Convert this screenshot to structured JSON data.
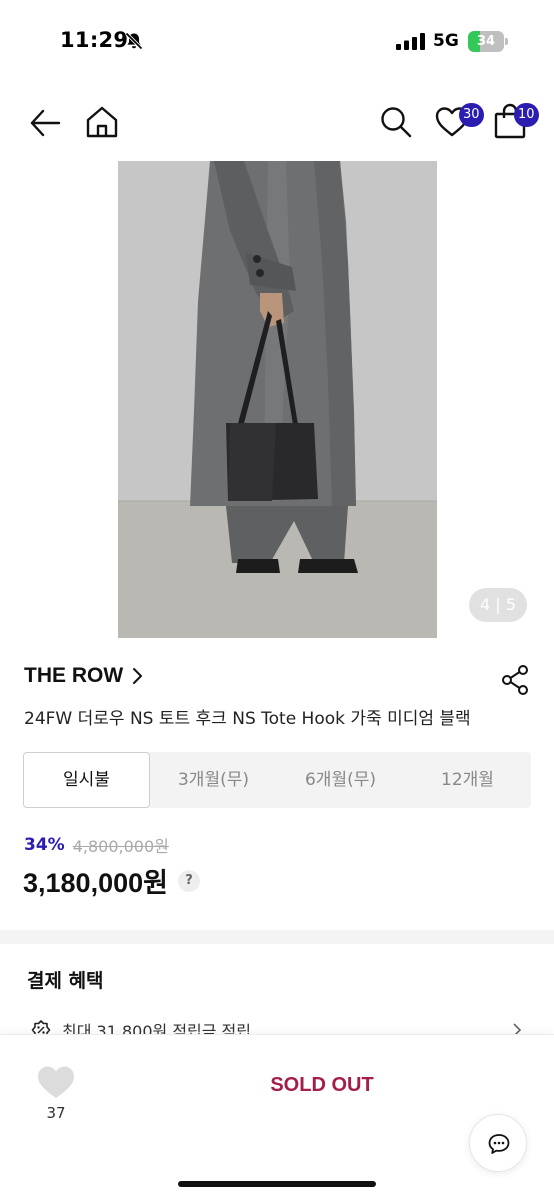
{
  "status_bar": {
    "time": "11:29",
    "network": "5G",
    "battery": "34",
    "battery_level": 0.34,
    "icons": [
      "bell-muted-icon",
      "signal-icon",
      "battery-charging-icon"
    ]
  },
  "header": {
    "icons": [
      "back-arrow-icon",
      "home-icon",
      "search-icon",
      "heart-icon",
      "shopping-bag-icon"
    ],
    "wishlist_count": "30",
    "cart_count": "10",
    "badge_color": "#2a1db0"
  },
  "gallery": {
    "counter_current": "4",
    "counter_separator": "|",
    "counter_total": "5"
  },
  "product": {
    "brand": "THE ROW",
    "title": "24FW 더로우 NS 토트 후크 NS Tote Hook 가죽 미디엄 블랙"
  },
  "installment_tabs": [
    {
      "label": "일시불",
      "active": true
    },
    {
      "label": "3개월(무)",
      "active": false
    },
    {
      "label": "6개월(무)",
      "active": false
    },
    {
      "label": "12개월",
      "active": false
    }
  ],
  "price": {
    "discount_rate": "34%",
    "original": "4,800,000원",
    "sale": "3,180,000원",
    "help_symbol": "?",
    "discount_color": "#2a1db0"
  },
  "benefits": {
    "title": "결제 혜택",
    "first_item": "최대 31,800원 적립금 적립"
  },
  "bottom_bar": {
    "like_count": "37",
    "status_label": "SOLD OUT",
    "status_color": "#a51d4b",
    "chat_icon": "chat-bubble-icon"
  }
}
